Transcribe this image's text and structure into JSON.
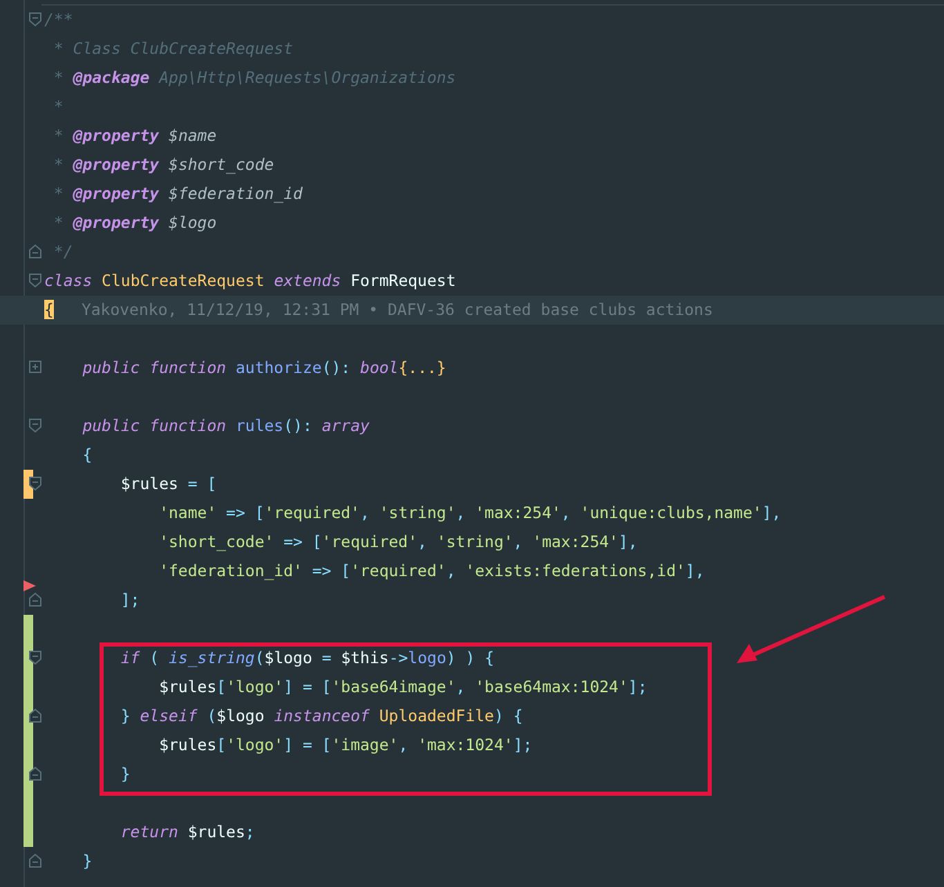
{
  "editor": {
    "lines": [
      {
        "fold_open": true,
        "tokens": [
          {
            "kind": "comment",
            "text": "/**"
          }
        ]
      },
      {
        "tokens": [
          {
            "kind": "comment",
            "text": " * Class ClubCreateRequest"
          }
        ]
      },
      {
        "tokens": [
          {
            "kind": "comment",
            "text": " * "
          },
          {
            "kind": "doctag",
            "text": "@package"
          },
          {
            "kind": "comment",
            "text": " App\\Http\\Requests\\Organizations"
          }
        ]
      },
      {
        "tokens": [
          {
            "kind": "comment",
            "text": " *"
          }
        ]
      },
      {
        "tokens": [
          {
            "kind": "comment",
            "text": " * "
          },
          {
            "kind": "doctag",
            "text": "@property"
          },
          {
            "kind": "docvar",
            "text": " $name"
          }
        ]
      },
      {
        "tokens": [
          {
            "kind": "comment",
            "text": " * "
          },
          {
            "kind": "doctag",
            "text": "@property"
          },
          {
            "kind": "docvar",
            "text": " $short_code"
          }
        ]
      },
      {
        "tokens": [
          {
            "kind": "comment",
            "text": " * "
          },
          {
            "kind": "doctag",
            "text": "@property"
          },
          {
            "kind": "docvar",
            "text": " $federation_id"
          }
        ]
      },
      {
        "tokens": [
          {
            "kind": "comment",
            "text": " * "
          },
          {
            "kind": "doctag",
            "text": "@property"
          },
          {
            "kind": "docvar",
            "text": " $logo"
          }
        ]
      },
      {
        "fold_close": true,
        "tokens": [
          {
            "kind": "comment",
            "text": " */"
          }
        ]
      },
      {
        "fold_open": true,
        "tokens": [
          {
            "kind": "kw",
            "text": "class"
          },
          {
            "kind": "cls",
            "text": " ClubCreateRequest "
          },
          {
            "kind": "kw",
            "text": "extends"
          },
          {
            "kind": "plain",
            "text": " FormRequest"
          }
        ]
      },
      {
        "current": true,
        "blame": "Yakovenko, 11/12/19, 12:31 PM • DAFV-36 created base clubs actions",
        "tokens": [
          {
            "kind": "brace",
            "text": "{"
          }
        ]
      },
      {
        "gap_above": true,
        "folded": true,
        "tokens": [
          {
            "kind": "kw",
            "text": "    public function"
          },
          {
            "kind": "fn",
            "text": " authorize"
          },
          {
            "kind": "punct",
            "text": "(): "
          },
          {
            "kind": "kw",
            "text": "bool"
          },
          {
            "kind": "folded",
            "text": "{...}"
          }
        ]
      },
      {
        "gap_above": true,
        "fold_open": true,
        "tokens": [
          {
            "kind": "kw",
            "text": "    public function"
          },
          {
            "kind": "fn",
            "text": " rules"
          },
          {
            "kind": "punct",
            "text": "(): "
          },
          {
            "kind": "kw",
            "text": "array"
          }
        ]
      },
      {
        "tokens": [
          {
            "kind": "punct",
            "text": "    {"
          }
        ]
      },
      {
        "modified": true,
        "fold_open": true,
        "tokens": [
          {
            "kind": "var",
            "text": "        $rules"
          },
          {
            "kind": "punct",
            "text": " = ["
          }
        ]
      },
      {
        "tokens": [
          {
            "kind": "str",
            "text": "            'name'"
          },
          {
            "kind": "punct",
            "text": " => ["
          },
          {
            "kind": "str",
            "text": "'required'"
          },
          {
            "kind": "punct",
            "text": ", "
          },
          {
            "kind": "str",
            "text": "'string'"
          },
          {
            "kind": "punct",
            "text": ", "
          },
          {
            "kind": "str",
            "text": "'max:254'"
          },
          {
            "kind": "punct",
            "text": ", "
          },
          {
            "kind": "str",
            "text": "'unique:clubs,name'"
          },
          {
            "kind": "punct",
            "text": "],"
          }
        ]
      },
      {
        "tokens": [
          {
            "kind": "str",
            "text": "            'short_code'"
          },
          {
            "kind": "punct",
            "text": " => ["
          },
          {
            "kind": "str",
            "text": "'required'"
          },
          {
            "kind": "punct",
            "text": ", "
          },
          {
            "kind": "str",
            "text": "'string'"
          },
          {
            "kind": "punct",
            "text": ", "
          },
          {
            "kind": "str",
            "text": "'max:254'"
          },
          {
            "kind": "punct",
            "text": "],"
          }
        ]
      },
      {
        "tokens": [
          {
            "kind": "str",
            "text": "            'federation_id'"
          },
          {
            "kind": "punct",
            "text": " => ["
          },
          {
            "kind": "str",
            "text": "'required'"
          },
          {
            "kind": "punct",
            "text": ", "
          },
          {
            "kind": "str",
            "text": "'exists:federations,id'"
          },
          {
            "kind": "punct",
            "text": "],"
          }
        ]
      },
      {
        "deleted_above": true,
        "fold_close": true,
        "tokens": [
          {
            "kind": "punct",
            "text": "        ];"
          }
        ]
      },
      {
        "added": true
      },
      {
        "added": true,
        "boxed": true,
        "fold_open": true,
        "tokens": [
          {
            "kind": "kw",
            "text": "        if"
          },
          {
            "kind": "punct",
            "text": " ( "
          },
          {
            "kind": "fni",
            "text": "is_string"
          },
          {
            "kind": "punct",
            "text": "("
          },
          {
            "kind": "var",
            "text": "$logo"
          },
          {
            "kind": "punct",
            "text": " = "
          },
          {
            "kind": "var",
            "text": "$this"
          },
          {
            "kind": "punct",
            "text": "->"
          },
          {
            "kind": "fn",
            "text": "logo"
          },
          {
            "kind": "punct",
            "text": ") ) {"
          }
        ]
      },
      {
        "added": true,
        "boxed": true,
        "tokens": [
          {
            "kind": "var",
            "text": "            $rules"
          },
          {
            "kind": "punct",
            "text": "["
          },
          {
            "kind": "str",
            "text": "'logo'"
          },
          {
            "kind": "punct",
            "text": "] = ["
          },
          {
            "kind": "str",
            "text": "'base64image'"
          },
          {
            "kind": "punct",
            "text": ", "
          },
          {
            "kind": "str",
            "text": "'base64max:1024'"
          },
          {
            "kind": "punct",
            "text": "];"
          }
        ]
      },
      {
        "added": true,
        "boxed": true,
        "fold_close": true,
        "tokens": [
          {
            "kind": "punct",
            "text": "        } "
          },
          {
            "kind": "kw",
            "text": "elseif"
          },
          {
            "kind": "punct",
            "text": " ("
          },
          {
            "kind": "var",
            "text": "$logo "
          },
          {
            "kind": "kw",
            "text": "instanceof"
          },
          {
            "kind": "cls",
            "text": " UploadedFile"
          },
          {
            "kind": "punct",
            "text": ") {"
          }
        ]
      },
      {
        "added": true,
        "boxed": true,
        "tokens": [
          {
            "kind": "var",
            "text": "            $rules"
          },
          {
            "kind": "punct",
            "text": "["
          },
          {
            "kind": "str",
            "text": "'logo'"
          },
          {
            "kind": "punct",
            "text": "] = ["
          },
          {
            "kind": "str",
            "text": "'image'"
          },
          {
            "kind": "punct",
            "text": ", "
          },
          {
            "kind": "str",
            "text": "'max:1024'"
          },
          {
            "kind": "punct",
            "text": "];"
          }
        ]
      },
      {
        "added": true,
        "boxed": true,
        "fold_close": true,
        "tokens": [
          {
            "kind": "punct",
            "text": "        }"
          }
        ]
      },
      {
        "added": true
      },
      {
        "added": true,
        "tokens": [
          {
            "kind": "kw",
            "text": "        return"
          },
          {
            "kind": "var",
            "text": " $rules"
          },
          {
            "kind": "punct",
            "text": ";"
          }
        ]
      },
      {
        "fold_close": true,
        "tokens": [
          {
            "kind": "punct",
            "text": "    }"
          }
        ]
      }
    ]
  }
}
